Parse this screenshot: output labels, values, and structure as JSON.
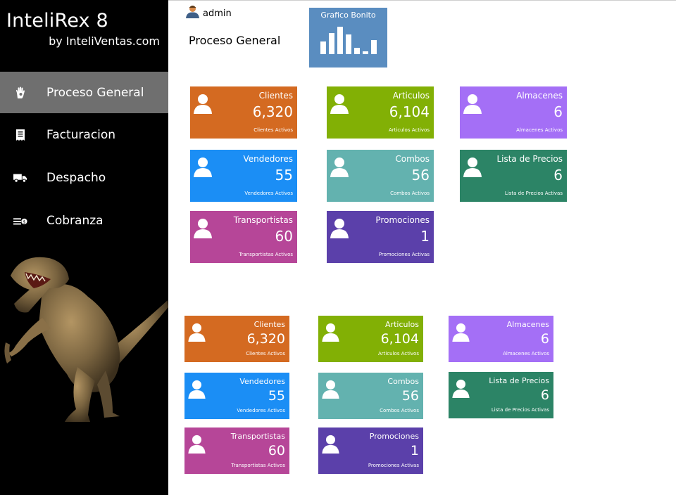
{
  "sidebar": {
    "brand_title": "InteliRex 8",
    "brand_sub": "by InteliVentas.com",
    "items": [
      {
        "label": "Proceso General",
        "icon": "hand-icon",
        "active": true
      },
      {
        "label": "Facturacion",
        "icon": "receipt-icon",
        "active": false
      },
      {
        "label": "Despacho",
        "icon": "truck-icon",
        "active": false
      },
      {
        "label": "Cobranza",
        "icon": "cash-icon",
        "active": false
      }
    ],
    "image": "t-rex-dinosaur"
  },
  "header": {
    "user": "admin",
    "page_title": "Proceso General",
    "chart_tile_label": "Grafico Bonito"
  },
  "tiles_a": [
    {
      "title": "Clientes",
      "value": "6,320",
      "sub": "Clientes Activos",
      "color": "#d46a21"
    },
    {
      "title": "Articulos",
      "value": "6,104",
      "sub": "Articulos Activos",
      "color": "#82b005"
    },
    {
      "title": "Almacenes",
      "value": "6",
      "sub": "Almacenes Activos",
      "color": "#a46ff6"
    },
    {
      "title": "Vendedores",
      "value": "55",
      "sub": "Vendedores Activos",
      "color": "#1b8ef5"
    },
    {
      "title": "Combos",
      "value": "56",
      "sub": "Combos Activos",
      "color": "#63b2af"
    },
    {
      "title": "Lista de Precios",
      "value": "6",
      "sub": "Lista de Precios Activas",
      "color": "#2c8466"
    },
    {
      "title": "Transportistas",
      "value": "60",
      "sub": "Transportistas Activos",
      "color": "#b64698"
    },
    {
      "title": "Promociones",
      "value": "1",
      "sub": "Promociones Activas",
      "color": "#5b40aa"
    }
  ],
  "tiles_b": [
    {
      "title": "Clientes",
      "value": "6,320",
      "sub": "Clientes Activos",
      "color": "#d46a21"
    },
    {
      "title": "Articulos",
      "value": "6,104",
      "sub": "Articulos Activos",
      "color": "#82b005"
    },
    {
      "title": "Almacenes",
      "value": "6",
      "sub": "Almacenes Activos",
      "color": "#a46ff6"
    },
    {
      "title": "Vendedores",
      "value": "55",
      "sub": "Vendedores Activos",
      "color": "#1b8ef5"
    },
    {
      "title": "Combos",
      "value": "56",
      "sub": "Combos Activos",
      "color": "#63b2af"
    },
    {
      "title": "Lista de Precios",
      "value": "6",
      "sub": "Lista de Precios Activas",
      "color": "#2c8466"
    },
    {
      "title": "Transportistas",
      "value": "60",
      "sub": "Transportistas Activos",
      "color": "#b64698"
    },
    {
      "title": "Promociones",
      "value": "1",
      "sub": "Promociones Activas",
      "color": "#5b40aa"
    }
  ]
}
